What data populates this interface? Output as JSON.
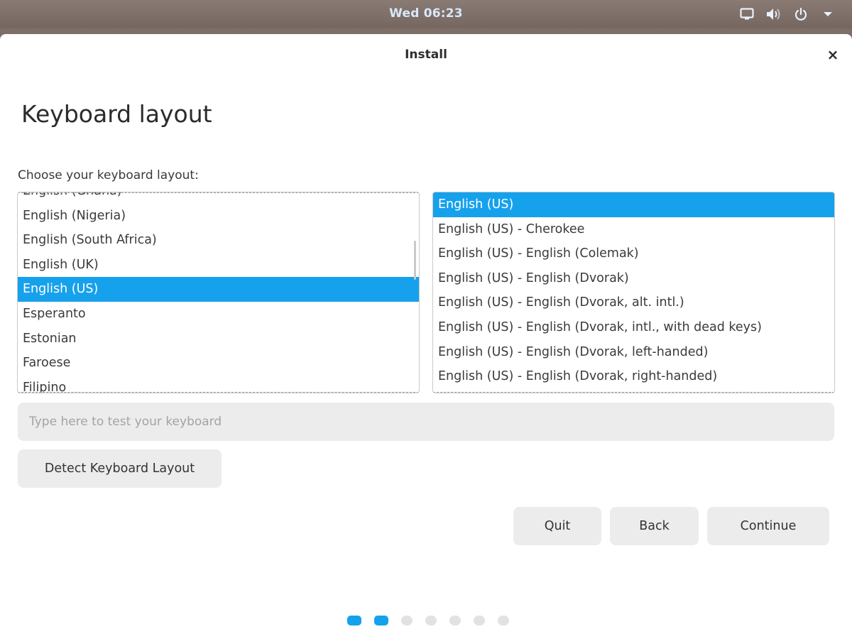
{
  "topbar": {
    "clock": "Wed 06:23",
    "icons": [
      "display-icon",
      "volume-icon",
      "power-icon",
      "chevron-down-icon"
    ]
  },
  "window": {
    "title": "Install",
    "close_label": "×"
  },
  "page": {
    "title": "Keyboard layout",
    "choose_label": "Choose your keyboard layout:"
  },
  "layouts": {
    "items": [
      "English (Ghana)",
      "English (Nigeria)",
      "English (South Africa)",
      "English (UK)",
      "English (US)",
      "Esperanto",
      "Estonian",
      "Faroese",
      "Filipino"
    ],
    "selected_index": 4
  },
  "variants": {
    "items": [
      "English (US)",
      "English (US) - Cherokee",
      "English (US) - English (Colemak)",
      "English (US) - English (Dvorak)",
      "English (US) - English (Dvorak, alt. intl.)",
      "English (US) - English (Dvorak, intl., with dead keys)",
      "English (US) - English (Dvorak, left-handed)",
      "English (US) - English (Dvorak, right-handed)"
    ],
    "selected_index": 0
  },
  "test_input": {
    "placeholder": "Type here to test your keyboard",
    "value": ""
  },
  "buttons": {
    "detect": "Detect Keyboard Layout",
    "quit": "Quit",
    "back": "Back",
    "continue": "Continue"
  },
  "progress": {
    "total_steps": 7,
    "completed_steps": 2
  },
  "colors": {
    "accent": "#16a1ec",
    "button_bg": "#ececec",
    "topbar_bg": "#7d6e68"
  }
}
